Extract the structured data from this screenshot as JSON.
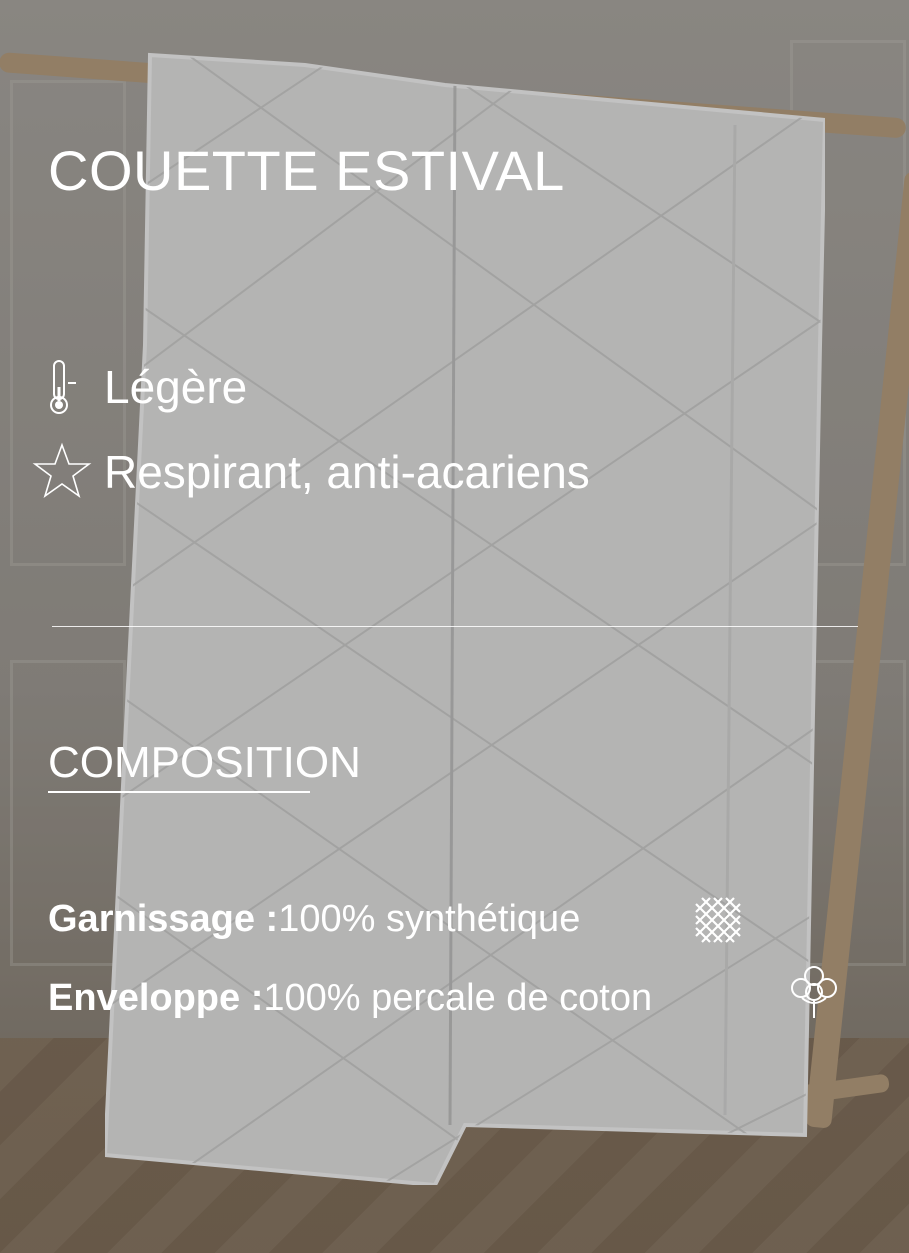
{
  "title": "COUETTE ESTIVAL",
  "features": [
    {
      "icon": "thermometer-icon",
      "label": "Légère"
    },
    {
      "icon": "star-icon",
      "label": "Respirant, anti-acariens"
    }
  ],
  "composition": {
    "title": "COMPOSITION",
    "rows": [
      {
        "key": "Garnissage :",
        "value": " 100% synthétique",
        "icon": "synthetic-fiber-icon"
      },
      {
        "key": "Enveloppe  :",
        "value": " 100% percale de coton",
        "icon": "cotton-flower-icon"
      }
    ]
  },
  "colors": {
    "text": "#ffffff",
    "wood": "#a88e6c",
    "duvet": "#d8d8d8"
  }
}
